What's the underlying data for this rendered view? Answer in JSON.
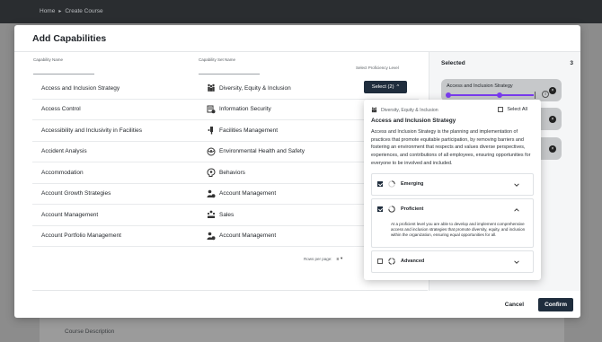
{
  "breadcrumb": {
    "home": "Home",
    "current": "Create Course"
  },
  "background": {
    "course_description": "Course Description"
  },
  "modal": {
    "title": "Add Capabilities",
    "fields": {
      "capability_name": "Capability Name",
      "capability_set_name": "Capability Set Name",
      "proficiency_level": "Select Proficiency Level"
    },
    "rows": [
      {
        "name": "Access and Inclusion Strategy",
        "set": "Diversity, Equity & Inclusion",
        "icon": "people-icon"
      },
      {
        "name": "Access Control",
        "set": "Information Security",
        "icon": "security-icon"
      },
      {
        "name": "Accessibility and Inclusivity in Facilities",
        "set": "Facilities Management",
        "icon": "facilities-icon"
      },
      {
        "name": "Accident Analysis",
        "set": "Environmental Health and Safety",
        "icon": "globe-icon"
      },
      {
        "name": "Accommodation",
        "set": "Behaviors",
        "icon": "brain-icon"
      },
      {
        "name": "Account Growth Strategies",
        "set": "Account Management",
        "icon": "account-icon"
      },
      {
        "name": "Account Management",
        "set": "Sales",
        "icon": "sales-icon"
      },
      {
        "name": "Account Portfolio Management",
        "set": "Account Management",
        "icon": "account-icon"
      }
    ],
    "select_button": "Select (2)",
    "pager": {
      "rows_per_page": "Rows per page:",
      "value": "8"
    },
    "cancel": "Cancel",
    "confirm": "Confirm"
  },
  "selected_panel": {
    "title": "Selected",
    "count": "3",
    "chips": [
      {
        "label": "Access and Inclusion Strategy"
      }
    ],
    "slider_level": 0.6
  },
  "dropdown": {
    "set_label": "Diversity, Equity & Inclusion",
    "select_all": "Select All",
    "title": "Access and Inclusion Strategy",
    "description": "Access and Inclusion Strategy is the planning and implementation of practices that promote equitable participation, by removing barriers and fostering an environment that respects and values diverse perspectives, experiences, and contributions of all employees, ensuring opportunities for everyone to be involved and included.",
    "levels": [
      {
        "name": "Emerging",
        "checked": true,
        "expanded": false
      },
      {
        "name": "Proficient",
        "checked": true,
        "expanded": true,
        "description": "At a proficient level you are able to develop and implement comprehensive access and inclusion strategies that promote diversity, equity, and inclusion within the organization, ensuring equal opportunities for all."
      },
      {
        "name": "Advanced",
        "checked": false,
        "expanded": false
      }
    ]
  },
  "colors": {
    "accent": "#7a3cf0",
    "primary_button": "#1f2d3d"
  }
}
